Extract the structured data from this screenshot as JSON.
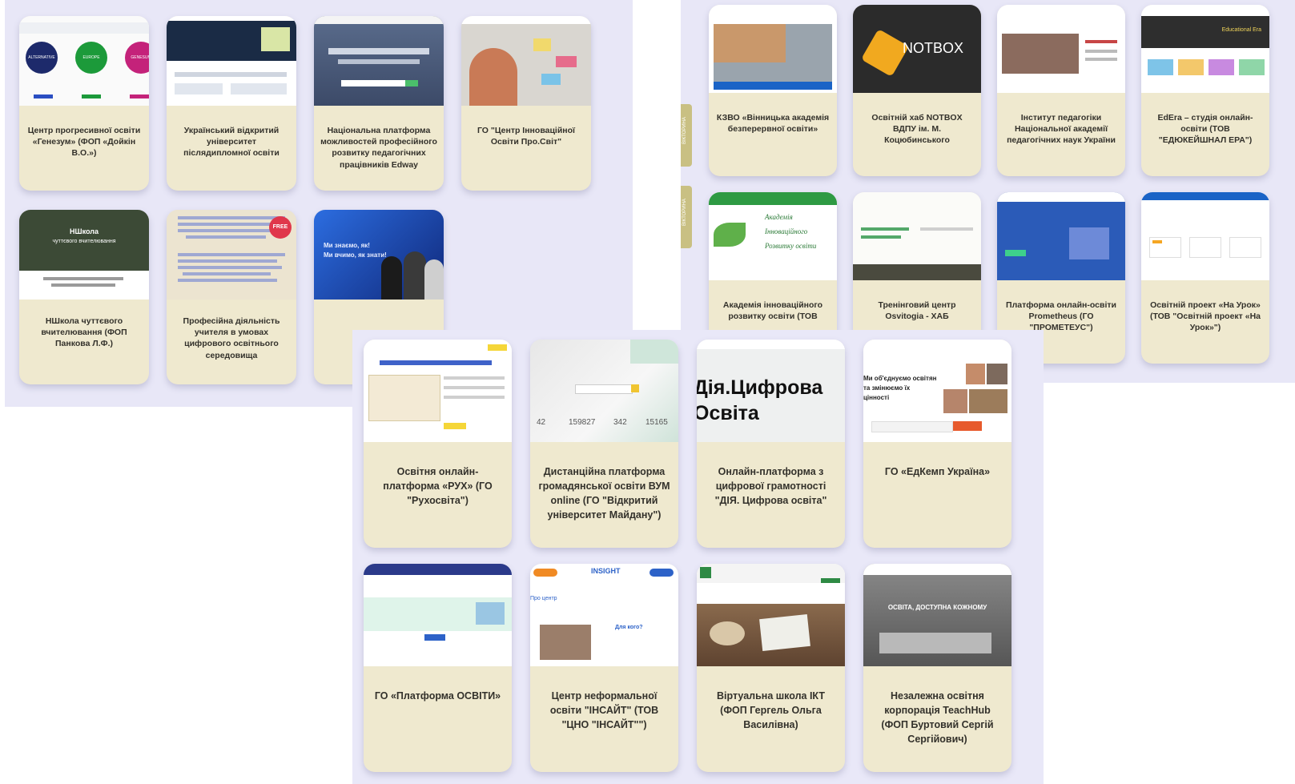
{
  "panels": {
    "left": {
      "cards": [
        {
          "title": "Центр прогресивної освіти «Генезум» (ФОП «Дойкін В.О.»)",
          "thumb_texts": [
            "ALTERNATIVE",
            "EUROPE",
            "GENESUM"
          ]
        },
        {
          "title": "Український відкритий університет післядипломної освіти",
          "thumb_texts": []
        },
        {
          "title": "Національна платформа можливостей професійного розвитку педагогічних працівників Edway",
          "thumb_texts": []
        },
        {
          "title": "ГО \"Центр Інноваційної Освіти Про.Світ\"",
          "thumb_texts": []
        },
        {
          "title": "НШкола чуттєвого вчителювання (ФОП Панкова Л.Ф.)",
          "thumb_texts": [
            "НШкола",
            "чуттєвого вчителювання"
          ]
        },
        {
          "title": "Професійна діяльність учителя в умовах цифрового освітнього середовища",
          "thumb_texts": [
            "FREE"
          ]
        },
        {
          "title": "",
          "thumb_texts": [
            "Ми знаємо, як!",
            "Ми вчимо, як знати!"
          ]
        }
      ]
    },
    "right": {
      "side_tabs": [
        "ВІКТОРИНА",
        "ВІКТОРИНА"
      ],
      "cards": [
        {
          "title": "КЗВО «Вінницька академія безперервної освіти»",
          "thumb_texts": []
        },
        {
          "title": "Освітній хаб NOTBOX ВДПУ ім. М. Коцюбинського",
          "thumb_texts": [
            "NOTBOX"
          ]
        },
        {
          "title": "Інститут педагогіки Національної академії педагогічних наук України",
          "thumb_texts": []
        },
        {
          "title": "EdEra – студія онлайн-освіти (ТОВ \"ЕДЮКЕЙШНАЛ ЕРА\")",
          "thumb_texts": [
            "Educational Era"
          ]
        },
        {
          "title": "Академія інноваційного розвитку освіти (ТОВ",
          "thumb_texts": [
            "Академія",
            "Інноваційного",
            "Розвитку освіти"
          ]
        },
        {
          "title": "Тренінговий центр Osvitogia - ХАБ",
          "thumb_texts": []
        },
        {
          "title": "Платформа онлайн-освіти Prometheus (ГО \"ПРОМЕТЕУС\")",
          "thumb_texts": []
        },
        {
          "title": "Освітній проект «На Урок» (ТОВ \"Освітній проект «На Урок»\")",
          "thumb_texts": []
        }
      ]
    },
    "center": {
      "cards": [
        {
          "title": "Освітня онлайн-платформа «РУХ» (ГО \"Рухосвіта\")",
          "thumb_texts": []
        },
        {
          "title": "Дистанційна платформа громадянської освіти ВУМ online (ГО \"Відкритий університет Майдану\")",
          "thumb_texts": [
            "42",
            "159827",
            "342",
            "15165"
          ]
        },
        {
          "title": "Онлайн-платформа з цифрової грамотності \"ДІЯ. Цифрова освіта\"",
          "thumb_texts": [
            "Дія.Цифрова",
            "Освіта"
          ]
        },
        {
          "title": "ГО «ЕдКемп Україна»",
          "thumb_texts": [
            "Ми об'єднуємо освітян",
            "та змінюємо їх",
            "цінності"
          ]
        },
        {
          "title": "ГО «Платформа ОСВІТИ»",
          "thumb_texts": []
        },
        {
          "title": "Центр неформальної освіти \"ІНСАЙТ\" (ТОВ \"ЦНО \"ІНСАЙТ\"\")",
          "thumb_texts": [
            "INSIGHT",
            "Для кого?",
            "Про центр"
          ]
        },
        {
          "title": "Віртуальна школа ІКТ (ФОП Гергель Ольга Василівна)",
          "thumb_texts": []
        },
        {
          "title": "Незалежна освітня корпорація TeachHub (ФОП Буртовий Сергій Сергійович)",
          "thumb_texts": [
            "ОСВІТА, ДОСТУПНА КОЖНОМУ"
          ]
        }
      ]
    }
  },
  "colors": {
    "panel_bg": "#e8e7f7",
    "card_bg": "#efe9cf",
    "text": "#33312b"
  }
}
